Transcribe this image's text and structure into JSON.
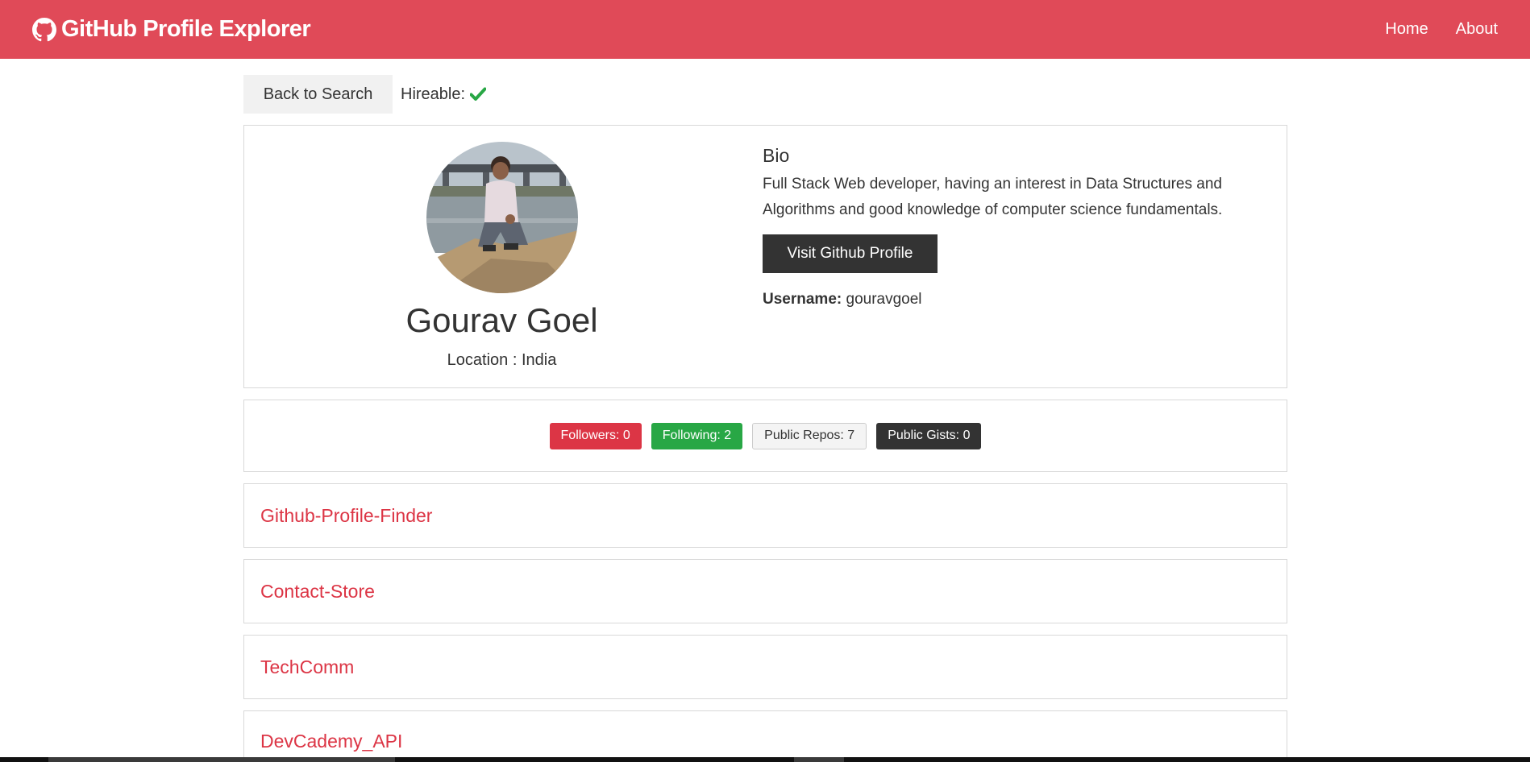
{
  "navbar": {
    "brand_icon": "github-icon",
    "brand": "GitHub Profile Explorer",
    "links": [
      {
        "label": "Home"
      },
      {
        "label": "About"
      }
    ],
    "background": "#e04a58"
  },
  "top": {
    "back_label": "Back to Search",
    "hireable_label": "Hireable:",
    "hireable_icon": "check-icon",
    "hireable_color": "#28a745"
  },
  "profile": {
    "name": "Gourav Goel",
    "location": "Location : India",
    "avatar": "avatar-photo",
    "bio_title": "Bio",
    "bio": "Full Stack Web developer, having an interest in Data Structures and Algorithms and good knowledge of computer science fundamentals.",
    "visit_label": "Visit Github Profile",
    "username_label": "Username:",
    "username": "gouravgoel"
  },
  "stats": {
    "followers": "Followers: 0",
    "following": "Following: 2",
    "repos": "Public Repos: 7",
    "gists": "Public Gists: 0"
  },
  "repos": [
    {
      "name": "Github-Profile-Finder"
    },
    {
      "name": "Contact-Store"
    },
    {
      "name": "TechComm"
    },
    {
      "name": "DevCademy_API"
    }
  ],
  "colors": {
    "accent": "#e04a58",
    "repo_link": "#dc3545",
    "dark": "#333333"
  }
}
